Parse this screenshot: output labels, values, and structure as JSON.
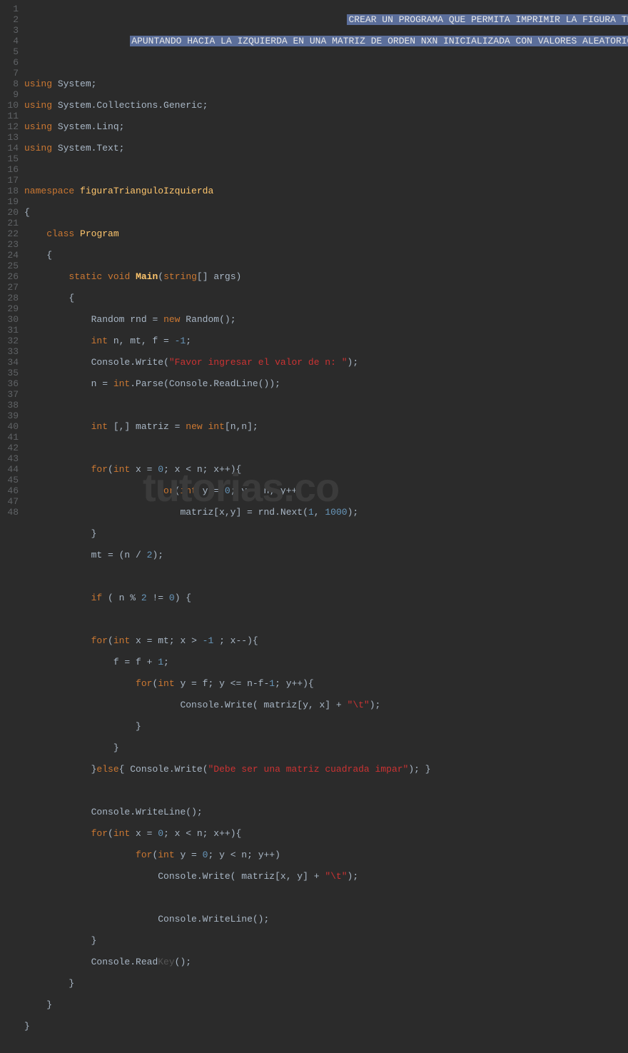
{
  "lineCount": 48,
  "watermark": "tutorias.co",
  "header": {
    "line1": "CREAR UN PROGRAMA QUE PERMITA IMPRIMIR LA FIGURA TRIANGULO",
    "line2": "APUNTANDO HACIA LA IZQUIERDA EN UNA MATRIZ DE ORDEN NXN INICIALIZADA CON VALORES ALEATORIOS"
  },
  "code": {
    "using": "using",
    "ns_System": "System",
    "ns_Generic": "System.Collections.Generic",
    "ns_Linq": "System.Linq",
    "ns_Text": "System.Text",
    "namespace_kw": "namespace",
    "namespace_name": "figuraTrianguloIzquierda",
    "class_kw": "class",
    "class_name": "Program",
    "static_kw": "static",
    "void_kw": "void",
    "main": "Main",
    "string_kw": "string",
    "args": "args",
    "Random": "Random",
    "rnd": "rnd",
    "new_kw": "new",
    "int_kw": "int",
    "vars_decl": "n, mt, f = ",
    "neg1": "-1",
    "Console": "Console",
    "Write": "Write",
    "WriteLine": "WriteLine",
    "ReadLine": "ReadLine",
    "ReadKey": "ReadKey",
    "Parse": "Parse",
    "Next": "Next",
    "prompt": "\"Favor ingresar el valor de n: \"",
    "matriz": "matriz",
    "for_kw": "for",
    "if_kw": "if",
    "else_kw": "else",
    "num0": "0",
    "num1": "1",
    "num2": "2",
    "num1000": "1000",
    "tab_str": "\"\\t\"",
    "err_str": "\"Debe ser una matriz cuadrada impar\""
  }
}
